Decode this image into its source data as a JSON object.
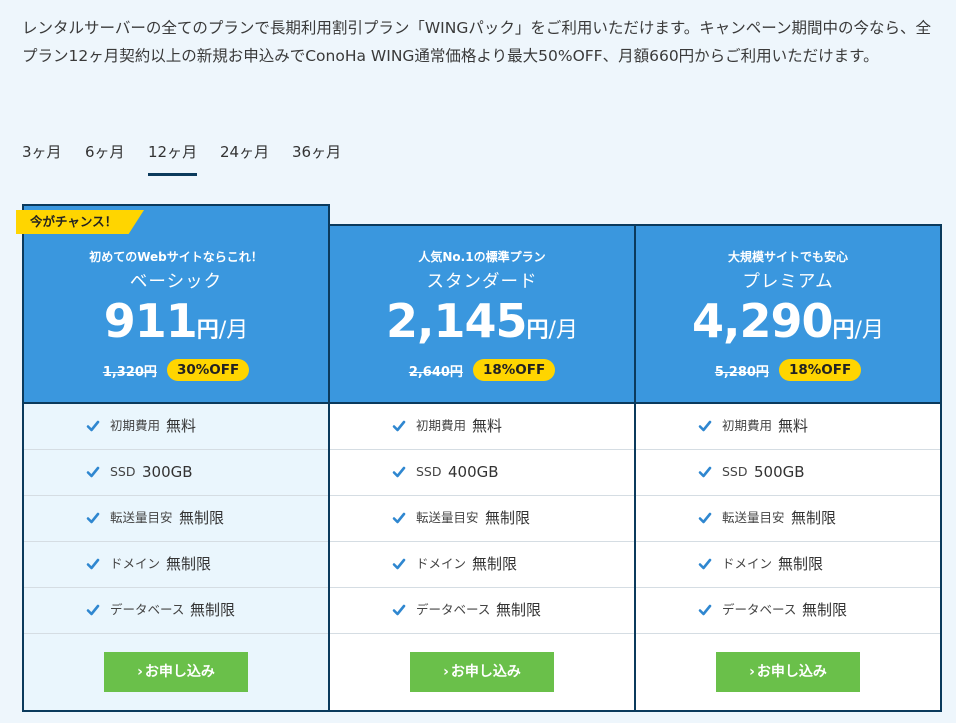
{
  "intro": "レンタルサーバーの全てのプランで長期利用割引プラン「WINGパック」をご利用いただけます。キャンペーン期間中の今なら、全プラン12ヶ月契約以上の新規お申込みでConoHa WING通常価格より最大50%OFF、月額660円からご利用いただけます。",
  "tabs": [
    {
      "label": "3ヶ月"
    },
    {
      "label": "6ヶ月"
    },
    {
      "label": "12ヶ月",
      "active": true
    },
    {
      "label": "24ヶ月"
    },
    {
      "label": "36ヶ月"
    }
  ],
  "badge": "今がチャンス！",
  "apply_label": "お申し込み",
  "colors": {
    "header_blue": "#3a97de",
    "border_navy": "#0b3a5c",
    "yellow": "#ffd500",
    "green": "#6ac04a",
    "check_blue": "#2f87d0"
  },
  "plans": [
    {
      "tagline": "初めてのWebサイトならこれ！",
      "name": "ベーシック",
      "price": "911",
      "yen": "円",
      "per": "/月",
      "old_price": "1,320円",
      "discount": "30%OFF",
      "features": [
        {
          "label": "初期費用",
          "value": "無料"
        },
        {
          "label": "SSD",
          "value": "300GB"
        },
        {
          "label": "転送量目安",
          "value": "無制限"
        },
        {
          "label": "ドメイン",
          "value": "無制限"
        },
        {
          "label": "データベース",
          "value": "無制限"
        }
      ]
    },
    {
      "tagline": "人気No.1の標準プラン",
      "name": "スタンダード",
      "price": "2,145",
      "yen": "円",
      "per": "/月",
      "old_price": "2,640円",
      "discount": "18%OFF",
      "features": [
        {
          "label": "初期費用",
          "value": "無料"
        },
        {
          "label": "SSD",
          "value": "400GB"
        },
        {
          "label": "転送量目安",
          "value": "無制限"
        },
        {
          "label": "ドメイン",
          "value": "無制限"
        },
        {
          "label": "データベース",
          "value": "無制限"
        }
      ]
    },
    {
      "tagline": "大規模サイトでも安心",
      "name": "プレミアム",
      "price": "4,290",
      "yen": "円",
      "per": "/月",
      "old_price": "5,280円",
      "discount": "18%OFF",
      "features": [
        {
          "label": "初期費用",
          "value": "無料"
        },
        {
          "label": "SSD",
          "value": "500GB"
        },
        {
          "label": "転送量目安",
          "value": "無制限"
        },
        {
          "label": "ドメイン",
          "value": "無制限"
        },
        {
          "label": "データベース",
          "value": "無制限"
        }
      ]
    }
  ]
}
